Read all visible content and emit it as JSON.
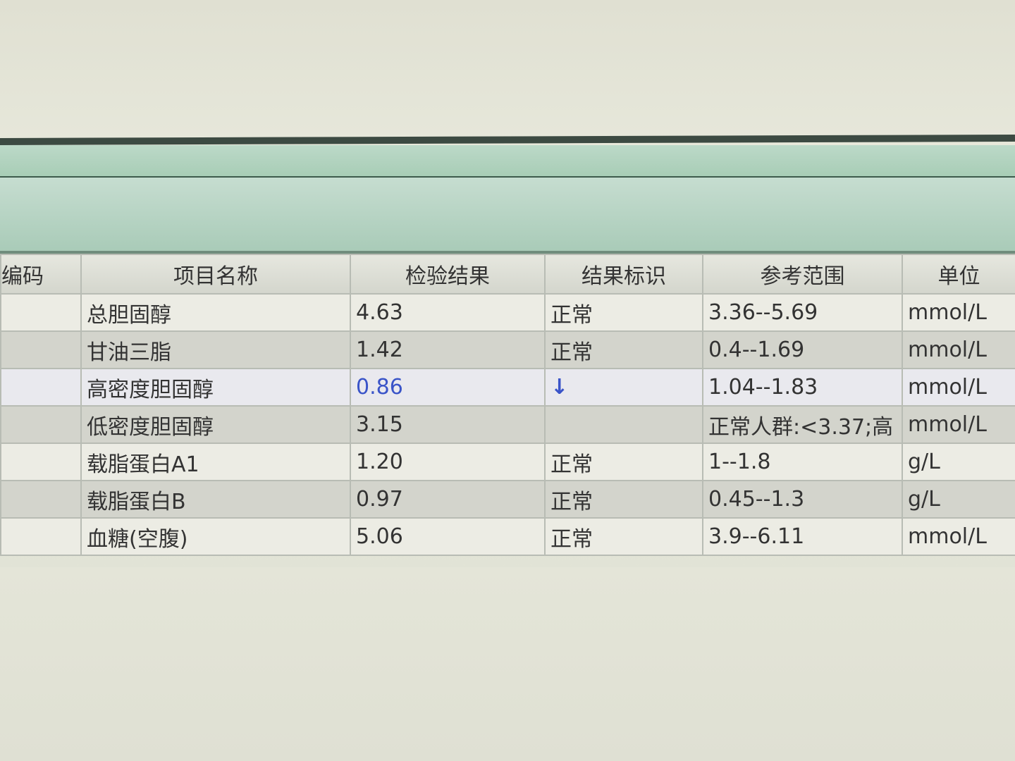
{
  "table": {
    "headers": {
      "code": "编码",
      "name": "项目名称",
      "result": "检验结果",
      "flag": "结果标识",
      "range": "参考范围",
      "unit": "单位"
    },
    "rows": [
      {
        "code": "",
        "name": "总胆固醇",
        "result": "4.63",
        "flag": "正常",
        "range": "3.36--5.69",
        "unit": "mmol/L"
      },
      {
        "code": "",
        "name": "甘油三脂",
        "result": "1.42",
        "flag": "正常",
        "range": "0.4--1.69",
        "unit": "mmol/L"
      },
      {
        "code": "",
        "name": "高密度胆固醇",
        "result": "0.86",
        "flag": "↓",
        "range": "1.04--1.83",
        "unit": "mmol/L"
      },
      {
        "code": "",
        "name": "低密度胆固醇",
        "result": "3.15",
        "flag": "",
        "range": "正常人群:<3.37;高",
        "unit": "mmol/L"
      },
      {
        "code": "",
        "name": "载脂蛋白A1",
        "result": "1.20",
        "flag": "正常",
        "range": "1--1.8",
        "unit": "g/L"
      },
      {
        "code": "",
        "name": "载脂蛋白B",
        "result": "0.97",
        "flag": "正常",
        "range": "0.45--1.3",
        "unit": "g/L"
      },
      {
        "code": "",
        "name": "血糖(空腹)",
        "result": "5.06",
        "flag": "正常",
        "range": "3.9--6.11",
        "unit": "mmol/L"
      }
    ]
  },
  "colors": {
    "abnormal": "#3a54c8",
    "header_green": "#a9cbb8"
  }
}
